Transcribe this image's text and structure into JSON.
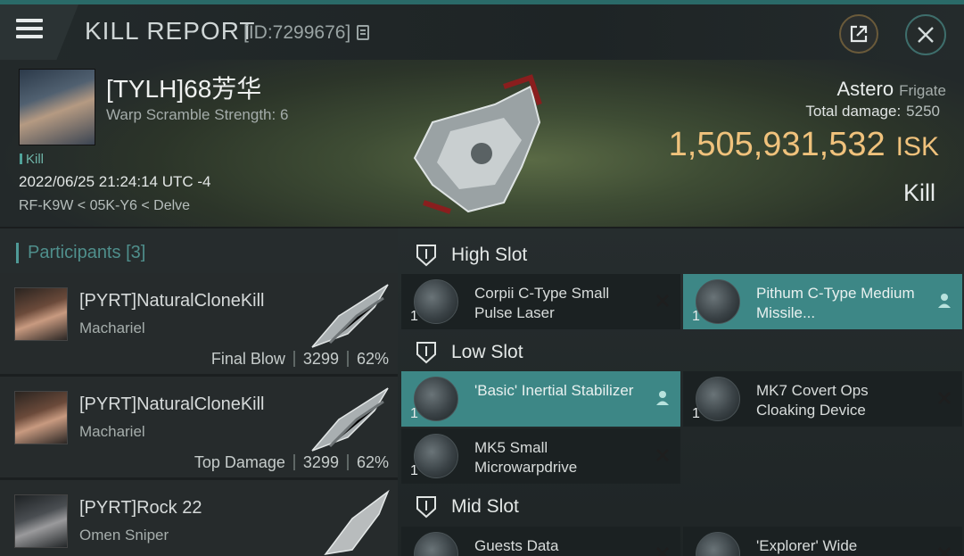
{
  "header": {
    "title": "KILL REPORT",
    "id_label": "[ID:7299676]"
  },
  "victim": {
    "name": "[TYLH]68芳华",
    "warp_scramble": "Warp Scramble Strength: 6",
    "tag": "Kill",
    "datetime": "2022/06/25 21:24:14 UTC -4",
    "location": "RF-K9W < 05K-Y6 < Delve"
  },
  "ship": {
    "name": "Astero",
    "class": "Frigate",
    "total_damage_label": "Total damage:",
    "total_damage": "5250",
    "isk_value": "1,505,931,532",
    "isk_unit": "ISK",
    "kill_type": "Kill"
  },
  "participants": {
    "title": "Participants",
    "count": "[3]",
    "rows": [
      {
        "name": "[PYRT]NaturalCloneKill",
        "ship": "Machariel",
        "role": "Final Blow",
        "damage": "3299",
        "percent": "62%"
      },
      {
        "name": "[PYRT]NaturalCloneKill",
        "ship": "Machariel",
        "role": "Top Damage",
        "damage": "3299",
        "percent": "62%"
      },
      {
        "name": "[PYRT]Rock 22",
        "ship": "Omen Sniper"
      }
    ]
  },
  "slots": {
    "high": {
      "label": "High Slot",
      "items": [
        {
          "qty": "1",
          "name": "Corpii C-Type Small Pulse Laser",
          "state": "destroyed"
        },
        {
          "qty": "1",
          "name": "Pithum C-Type Medium Missile...",
          "state": "dropped"
        }
      ]
    },
    "low": {
      "label": "Low Slot",
      "items": [
        {
          "qty": "1",
          "name": "'Basic' Inertial Stabilizer",
          "state": "dropped"
        },
        {
          "qty": "1",
          "name": "MK7 Covert Ops Cloaking Device",
          "state": "destroyed"
        },
        {
          "qty": "1",
          "name": "MK5 Small Microwarpdrive",
          "state": "destroyed"
        }
      ]
    },
    "mid": {
      "label": "Mid Slot",
      "items": [
        {
          "name": "Guests Data",
          "state": "destroyed"
        },
        {
          "name": "'Explorer' Wide",
          "state": "destroyed"
        }
      ]
    }
  },
  "colors": {
    "accent_teal": "#3d8786",
    "isk_gold": "#f0c27c"
  },
  "icons": [
    "menu-icon",
    "copy-icon",
    "external-link-icon",
    "close-icon",
    "slot-shield-icon",
    "destroyed-x-icon",
    "dropped-person-icon"
  ]
}
